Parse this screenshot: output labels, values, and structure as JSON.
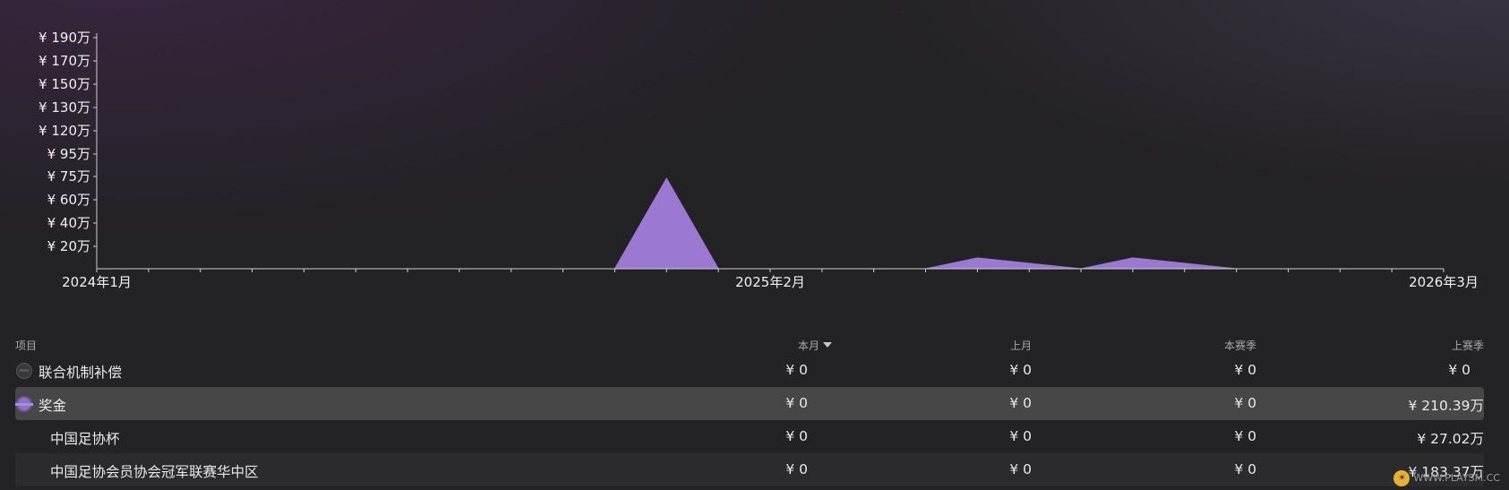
{
  "chart_data": {
    "type": "area",
    "y_ticks": [
      "¥ 20万",
      "¥ 40万",
      "¥ 60万",
      "¥ 75万",
      "¥ 95万",
      "¥ 120万",
      "¥ 130万",
      "¥ 150万",
      "¥ 170万",
      "¥ 190万"
    ],
    "x_labels": [
      "2024年1月",
      "2025年2月",
      "2026年3月"
    ],
    "ylim": [
      0,
      1900000
    ],
    "months": 26,
    "series": [
      {
        "color": "#9b79d2",
        "points": [
          [
            10,
            0
          ],
          [
            11,
            750000
          ],
          [
            12,
            0
          ],
          [
            16,
            0
          ],
          [
            17,
            90000
          ],
          [
            19,
            0
          ],
          [
            20,
            90000
          ],
          [
            22,
            0
          ]
        ]
      }
    ]
  },
  "table": {
    "headers": {
      "item": "项目",
      "this_month": "本月",
      "last_month": "上月",
      "this_season": "本赛季",
      "last_season": "上赛季"
    },
    "rows": [
      {
        "label": "联合机制补偿",
        "c1": "¥ 0",
        "c2": "¥ 0",
        "c3": "¥ 0",
        "c4": "¥ 0",
        "icon": "solidarity-icon"
      },
      {
        "label": "奖金",
        "c1": "¥ 0",
        "c2": "¥ 0",
        "c3": "¥ 0",
        "c4": "¥ 210.39万",
        "icon": "prize-money-icon"
      },
      {
        "label": "中国足协杯",
        "c1": "¥ 0",
        "c2": "¥ 0",
        "c3": "¥ 0",
        "c4": "¥ 27.02万"
      },
      {
        "label": "中国足协会员协会冠军联赛华中区",
        "c1": "¥ 0",
        "c2": "¥ 0",
        "c3": "¥ 0",
        "c4": "¥ 183.37万"
      }
    ]
  },
  "watermark": "WWW.PLAYSM.CC"
}
